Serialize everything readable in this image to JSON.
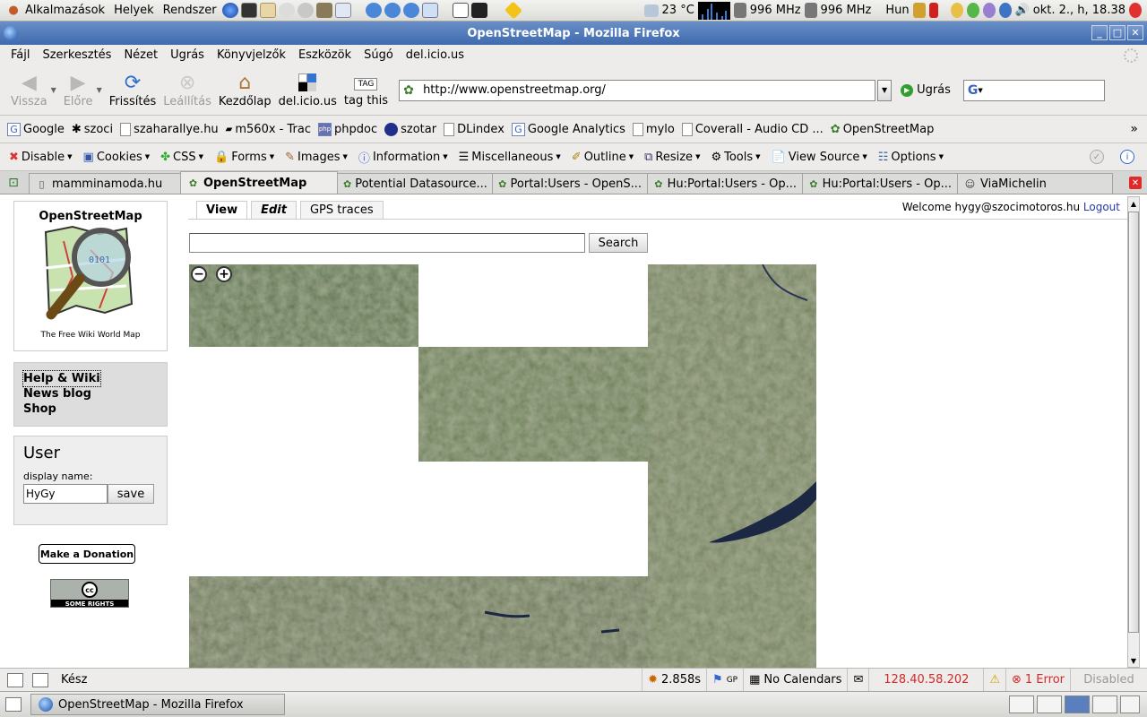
{
  "gnome_panel": {
    "menus": [
      "Alkalmazások",
      "Helyek",
      "Rendszer"
    ],
    "weather": "23 °C",
    "cpu1": "996 MHz",
    "cpu2": "996 MHz",
    "keyboard": "Hun",
    "clock": "okt. 2., h, 18.38"
  },
  "window": {
    "title": "OpenStreetMap - Mozilla Firefox"
  },
  "menubar": [
    "Fájl",
    "Szerkesztés",
    "Nézet",
    "Ugrás",
    "Könyvjelzők",
    "Eszközök",
    "Súgó",
    "del.icio.us"
  ],
  "navbar": {
    "back": "Vissza",
    "forward": "Előre",
    "reload": "Frissítés",
    "stop": "Leállítás",
    "home": "Kezdőlap",
    "delicious": "del.icio.us",
    "tag": "tag this",
    "tag_icon_text": "TAG",
    "url": "http://www.openstreetmap.org/",
    "go": "Ugrás"
  },
  "bookmarks": [
    "Google",
    "szoci",
    "szaharallye.hu",
    "m560x - Trac",
    "phpdoc",
    "szotar",
    "DLindex",
    "Google Analytics",
    "mylo",
    "Coverall - Audio CD ...",
    "OpenStreetMap"
  ],
  "webdev": [
    "Disable",
    "Cookies",
    "CSS",
    "Forms",
    "Images",
    "Information",
    "Miscellaneous",
    "Outline",
    "Resize",
    "Tools",
    "View Source",
    "Options"
  ],
  "tabs": [
    {
      "label": "mamminamoda.hu",
      "active": false
    },
    {
      "label": "OpenStreetMap",
      "active": true
    },
    {
      "label": "Potential Datasource...",
      "active": false
    },
    {
      "label": "Portal:Users - OpenS...",
      "active": false
    },
    {
      "label": "Hu:Portal:Users - Op...",
      "active": false
    },
    {
      "label": "Hu:Portal:Users - Op...",
      "active": false
    },
    {
      "label": "ViaMichelin",
      "active": false
    }
  ],
  "page": {
    "logo_title": "OpenStreetMap",
    "logo_subtitle": "The Free Wiki World Map",
    "links": [
      "Help & Wiki",
      "News blog",
      "Shop"
    ],
    "user_heading": "User",
    "display_name_label": "display name:",
    "display_name_value": "HyGy",
    "save": "save",
    "donate": "Make a Donation",
    "cc_text": "SOME RIGHTS RESERVED",
    "cc_logo": "cc",
    "map_tabs": [
      "View",
      "Edit",
      "GPS traces"
    ],
    "welcome": "Welcome hygy@szocimotoros.hu",
    "logout": "Logout",
    "search_button": "Search",
    "search_value": ""
  },
  "statusbar": {
    "status": "Kész",
    "timer": "2.858s",
    "gp": "GP",
    "calendars": "No Calendars",
    "ip": "128.40.58.202",
    "errors": "1 Error",
    "disabled": "Disabled"
  },
  "taskbar": {
    "task": "OpenStreetMap - Mozilla Firefox"
  },
  "colors": {
    "titlebar": "#4a74b6",
    "error_red": "#d12a2a",
    "ip_red": "#d12a2a",
    "map_green": "#5e7a4e"
  }
}
